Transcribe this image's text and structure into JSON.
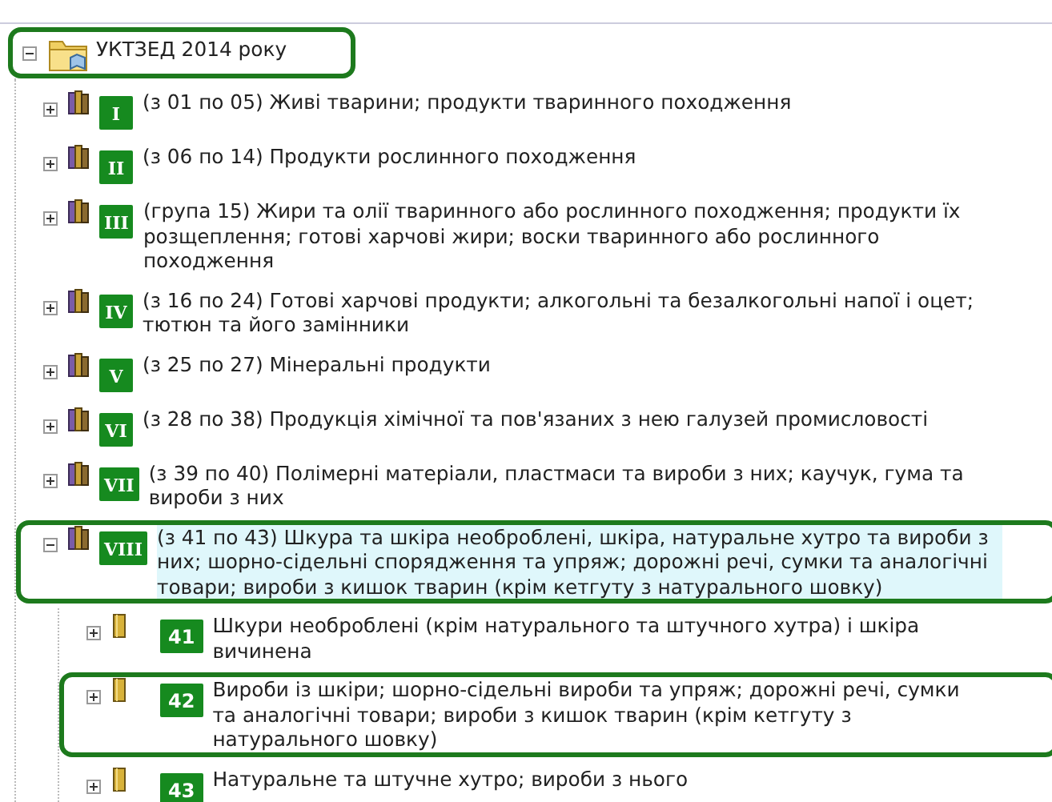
{
  "tree": {
    "label": "УКТЗЕД 2014 року",
    "expanded": true,
    "selected": false,
    "outlined": true,
    "children": [
      {
        "kind": "section",
        "badge": "I",
        "label": "(з 01 по 05) Живі тварини; продукти тваринного походження",
        "expanded": false,
        "selected": false,
        "outlined": false
      },
      {
        "kind": "section",
        "badge": "II",
        "label": "(з 06 по 14) Продукти рослинного походження",
        "expanded": false,
        "selected": false,
        "outlined": false
      },
      {
        "kind": "section",
        "badge": "III",
        "label": "(група 15) Жири та олії тваринного або рослинного походження; продукти їх розщеплення; готові харчові жири; воски тваринного або рослинного походження",
        "expanded": false,
        "selected": false,
        "outlined": false
      },
      {
        "kind": "section",
        "badge": "IV",
        "label": "(з 16 по 24) Готові харчові продукти; алкогольні та безалкогольні напої і оцет; тютюн та його замінники",
        "expanded": false,
        "selected": false,
        "outlined": false
      },
      {
        "kind": "section",
        "badge": "V",
        "label": "(з 25 по 27) Мінеральні продукти",
        "expanded": false,
        "selected": false,
        "outlined": false
      },
      {
        "kind": "section",
        "badge": "VI",
        "label": "(з 28 по 38) Продукція хімічної та пов'язаних з нею галузей промисловості",
        "expanded": false,
        "selected": false,
        "outlined": false
      },
      {
        "kind": "section",
        "badge": "VII",
        "label": "(з 39 по 40) Полімерні матеріали, пластмаси та вироби з них; каучук, гума та вироби з них",
        "expanded": false,
        "selected": false,
        "outlined": false
      },
      {
        "kind": "section",
        "badge": "VIII",
        "label": "(з 41 по 43) Шкура та шкіра необроблені, шкіра, натуральне хутро та вироби з них; шорно-сідельні спорядження та упряж; дорожні речі, сумки та аналогічні товари; вироби з кишок тварин (крім кетгуту з натурального шовку)",
        "expanded": true,
        "selected": true,
        "outlined": true,
        "children": [
          {
            "kind": "group",
            "badge": "41",
            "label": "Шкури необроблені (крім натурального та штучного хутра) і шкіра вичинена",
            "expanded": false,
            "selected": false,
            "outlined": false
          },
          {
            "kind": "group",
            "badge": "42",
            "label": "Вироби із шкіри; шорно-сідельні вироби та упряж; дорожні речі, сумки та аналогічні товари; вироби з кишок тварин (крім кетгуту з натурального шовку)",
            "expanded": false,
            "selected": false,
            "outlined": true
          },
          {
            "kind": "group",
            "badge": "43",
            "label": "Натуральне та штучне хутро; вироби з нього",
            "expanded": false,
            "selected": false,
            "outlined": false
          }
        ]
      }
    ]
  }
}
